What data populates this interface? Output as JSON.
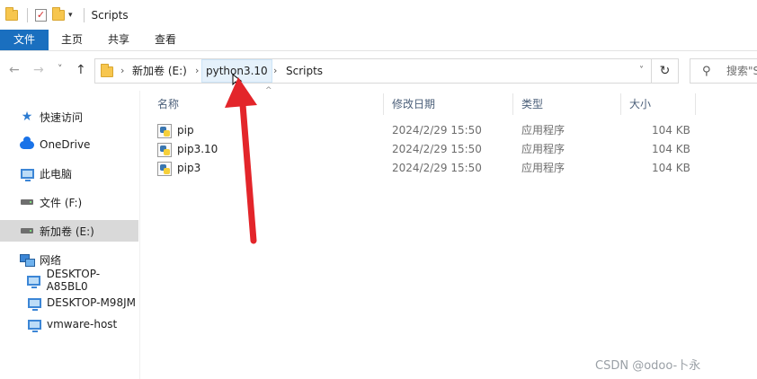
{
  "window": {
    "title": "Scripts",
    "qat_dropdown": "▾"
  },
  "ribbon": {
    "tabs": [
      {
        "label": "文件",
        "active": true
      },
      {
        "label": "主页"
      },
      {
        "label": "共享"
      },
      {
        "label": "查看"
      }
    ]
  },
  "nav": {
    "back": "←",
    "forward": "→",
    "recent": "˅",
    "up": "↑"
  },
  "address": {
    "breadcrumb": [
      "新加卷 (E:)",
      "python3.10",
      "Scripts"
    ],
    "highlighted_index": 1,
    "dropdown": "˅",
    "refresh": "↻"
  },
  "search": {
    "placeholder": "搜索\"S"
  },
  "sidebar": {
    "items": [
      {
        "label": "快速访问",
        "icon": "star-icon"
      },
      {
        "label": "OneDrive",
        "icon": "cloud-icon"
      },
      {
        "label": "此电脑",
        "icon": "computer-icon"
      },
      {
        "label": "文件 (F:)",
        "icon": "drive-icon"
      },
      {
        "label": "新加卷 (E:)",
        "icon": "drive-icon",
        "selected": true
      },
      {
        "label": "网络",
        "icon": "network-icon"
      },
      {
        "label": "DESKTOP-A85BL0",
        "icon": "computer-icon"
      },
      {
        "label": "DESKTOP-M98JM",
        "icon": "computer-icon"
      },
      {
        "label": "vmware-host",
        "icon": "computer-icon"
      }
    ]
  },
  "columns": {
    "name": "名称",
    "modified": "修改日期",
    "type": "类型",
    "size": "大小",
    "sort_caret": "^"
  },
  "files": [
    {
      "name": "pip",
      "modified": "2024/2/29 15:50",
      "type": "应用程序",
      "size": "104 KB"
    },
    {
      "name": "pip3.10",
      "modified": "2024/2/29 15:50",
      "type": "应用程序",
      "size": "104 KB"
    },
    {
      "name": "pip3",
      "modified": "2024/2/29 15:50",
      "type": "应用程序",
      "size": "104 KB"
    }
  ],
  "colors": {
    "file_tab": "#1a6fbf",
    "arrow": "#e3252a",
    "selected_sidebar": "#d9d9d9"
  },
  "watermark": "CSDN @odoo-卜永"
}
